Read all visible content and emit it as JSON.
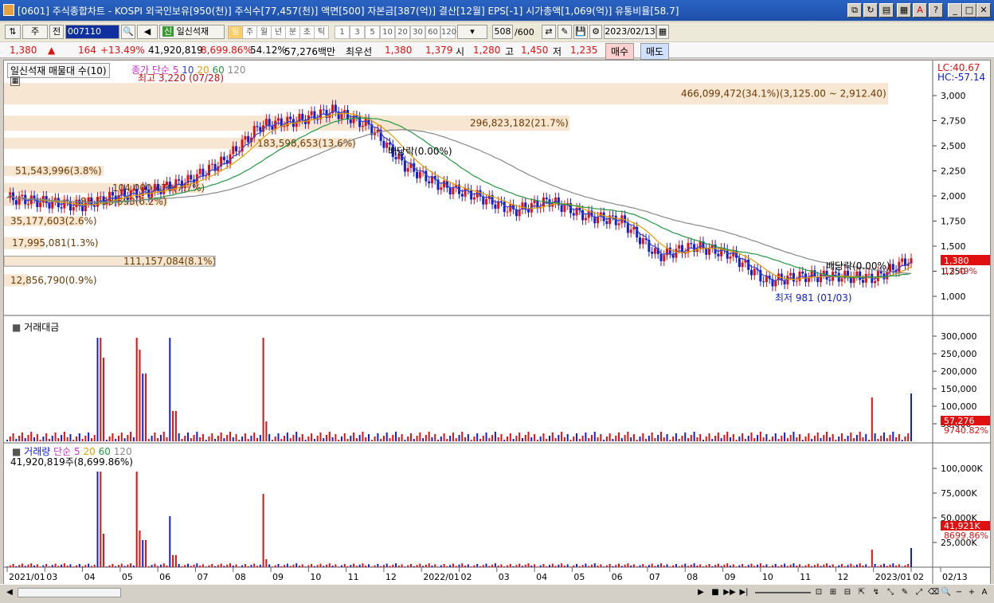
{
  "window": {
    "title": "[0601] 주식종합차트 - KOSPI 외국인보유[950(천)] 주식수[77,457(천)] 액면[500] 자본금[387(억)] 결산[12월] EPS[-1] 시가총액[1,069(억)] 유통비율[58.7]"
  },
  "toolbar": {
    "market": "주",
    "prev": "전",
    "code": "007110",
    "name": "일신석재",
    "periods": [
      "일",
      "주",
      "월",
      "년",
      "분",
      "초",
      "틱"
    ],
    "numbers": [
      "1",
      "3",
      "5",
      "10",
      "20",
      "30",
      "60",
      "120"
    ],
    "count": "508",
    "count_total": "/600",
    "date": "2023/02/13"
  },
  "quote": {
    "price": "1,380",
    "change": "164",
    "change_pct": "+13.49%",
    "volume": "41,920,819",
    "volume_pct": "8,699.86%",
    "ratio": "54.12%",
    "amount": "57,276백만",
    "best_label": "최우선",
    "ask": "1,380",
    "bid": "1,379",
    "open_label": "시",
    "open": "1,280",
    "high_label": "고",
    "high": "1,450",
    "low_label": "저",
    "low": "1,235",
    "buy": "매수",
    "sell": "매도"
  },
  "price_panel": {
    "title": "일신석재 매물대 수(10)",
    "ma_label": "종가 단순",
    "ma": [
      "5",
      "10",
      "20",
      "60",
      "120"
    ],
    "max_note": "최고 3,220 (07/28)",
    "min_note": "최저 981 (01/03)",
    "div1": "배당락(0.00%)",
    "div2": "배당락(0.00%)",
    "lc": "LC:40.67",
    "hc": "HC:-57.14",
    "last": "1,380",
    "last_pct": "13.49%",
    "yticks": [
      "3,000",
      "2,750",
      "2,500",
      "2,250",
      "2,000",
      "1,750",
      "1,500",
      "1,250",
      "1,000"
    ],
    "profile": [
      "466,099,472(34.1%)(3,125.00 ~ 2,912.40)",
      "296,823,182(21.7%)",
      "183,598,653(13.6%)",
      "51,543,996(3.8%)",
      "104,000,470(7.7%)",
      "85,033,693(6.2%)",
      "35,177,603(2.6%)",
      "17,995,081(1.3%)",
      "111,157,084(8.1%)",
      "12,856,790(0.9%)"
    ]
  },
  "amount_panel": {
    "title": "거래대금",
    "yticks": [
      "300,000",
      "250,000",
      "200,000",
      "150,000",
      "100,000",
      "50,000"
    ],
    "last": "57,276",
    "last_pct": "9740.82%"
  },
  "volume_panel": {
    "title": "거래량",
    "ma_label": "단순",
    "ma": [
      "5",
      "20",
      "60",
      "120"
    ],
    "info": "41,920,819주(8,699.86%)",
    "yticks": [
      "100,000K",
      "75,000K",
      "50,000K",
      "25,000K"
    ],
    "last": "41,921K",
    "last_pct": "8699.86%"
  },
  "xaxis": [
    "2021/01",
    "03",
    "04",
    "05",
    "06",
    "07",
    "08",
    "09",
    "10",
    "11",
    "12",
    "2022/01",
    "02",
    "03",
    "04",
    "05",
    "06",
    "07",
    "08",
    "09",
    "10",
    "11",
    "12",
    "2023/01",
    "02",
    "02/13"
  ],
  "colors": {
    "up": "#e01010",
    "down": "#1020d0",
    "ma5": "#cc33cc",
    "ma10": "#3344cc",
    "ma20": "#e0a000",
    "ma60": "#229944",
    "ma120": "#888888"
  },
  "chart_data": {
    "type": "candlestick",
    "x": [
      "2021/01",
      "2021/02",
      "2021/03",
      "2021/04",
      "2021/05",
      "2021/06",
      "2021/07",
      "2021/08",
      "2021/09",
      "2021/10",
      "2021/11",
      "2021/12",
      "2022/01",
      "2022/02",
      "2022/03",
      "2022/04",
      "2022/05",
      "2022/06",
      "2022/07",
      "2022/08",
      "2022/09",
      "2022/10",
      "2022/11",
      "2022/12",
      "2023/01",
      "2023/02"
    ],
    "close": [
      1980,
      1940,
      1900,
      2000,
      2050,
      2150,
      2350,
      2700,
      2750,
      2850,
      2700,
      2300,
      2100,
      2000,
      1850,
      1950,
      1800,
      1750,
      1400,
      1500,
      1420,
      1150,
      1200,
      1200,
      1180,
      1380
    ],
    "ylim": [
      900,
      3300
    ]
  }
}
